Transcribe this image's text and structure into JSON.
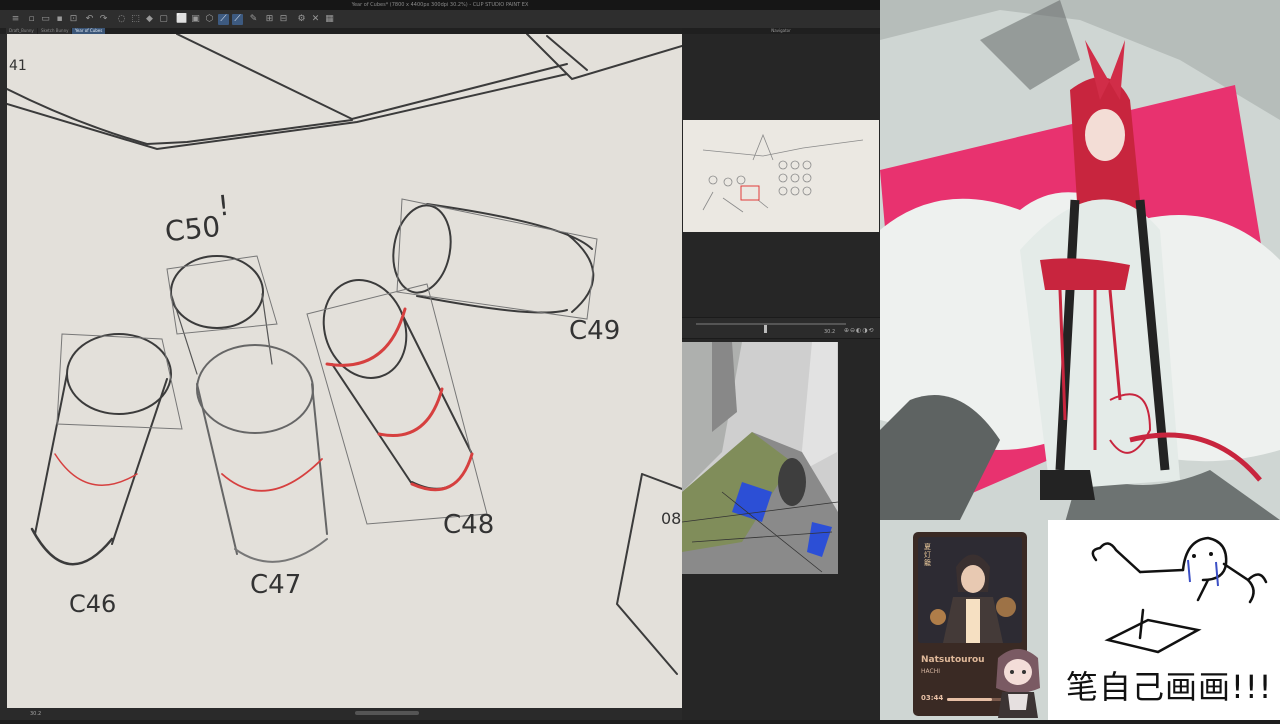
{
  "window": {
    "title": "Year of Cubes* (7800 x 4400px 300dpi 30.2%) - CLIP STUDIO PAINT EX"
  },
  "tabs": [
    {
      "label": "Draft_Bunny",
      "active": false
    },
    {
      "label": "Sketch Bunny",
      "active": false
    },
    {
      "label": "Year of Cubes",
      "active": true
    }
  ],
  "panels": {
    "navigator_title": "Navigator",
    "zoom_value": "30.2",
    "status_zoom": "30.2"
  },
  "canvas": {
    "labels": {
      "c50": "C50",
      "c50_mark": "!",
      "c49": "C49",
      "c46": "C46",
      "c47": "C47",
      "c48": "C48",
      "c08": "08",
      "c41": "41"
    }
  },
  "music": {
    "song": "Natsutourou",
    "artist": "HACHI",
    "time": "03:44",
    "progress": 0.7,
    "art_side_text": "夏灯籠"
  },
  "drawcard": {
    "caption": "笔自己画画!!!"
  },
  "colors": {
    "accent_red": "#d6403f",
    "pink_square": "#e8326f",
    "toolbar_active": "#3d5a80"
  }
}
